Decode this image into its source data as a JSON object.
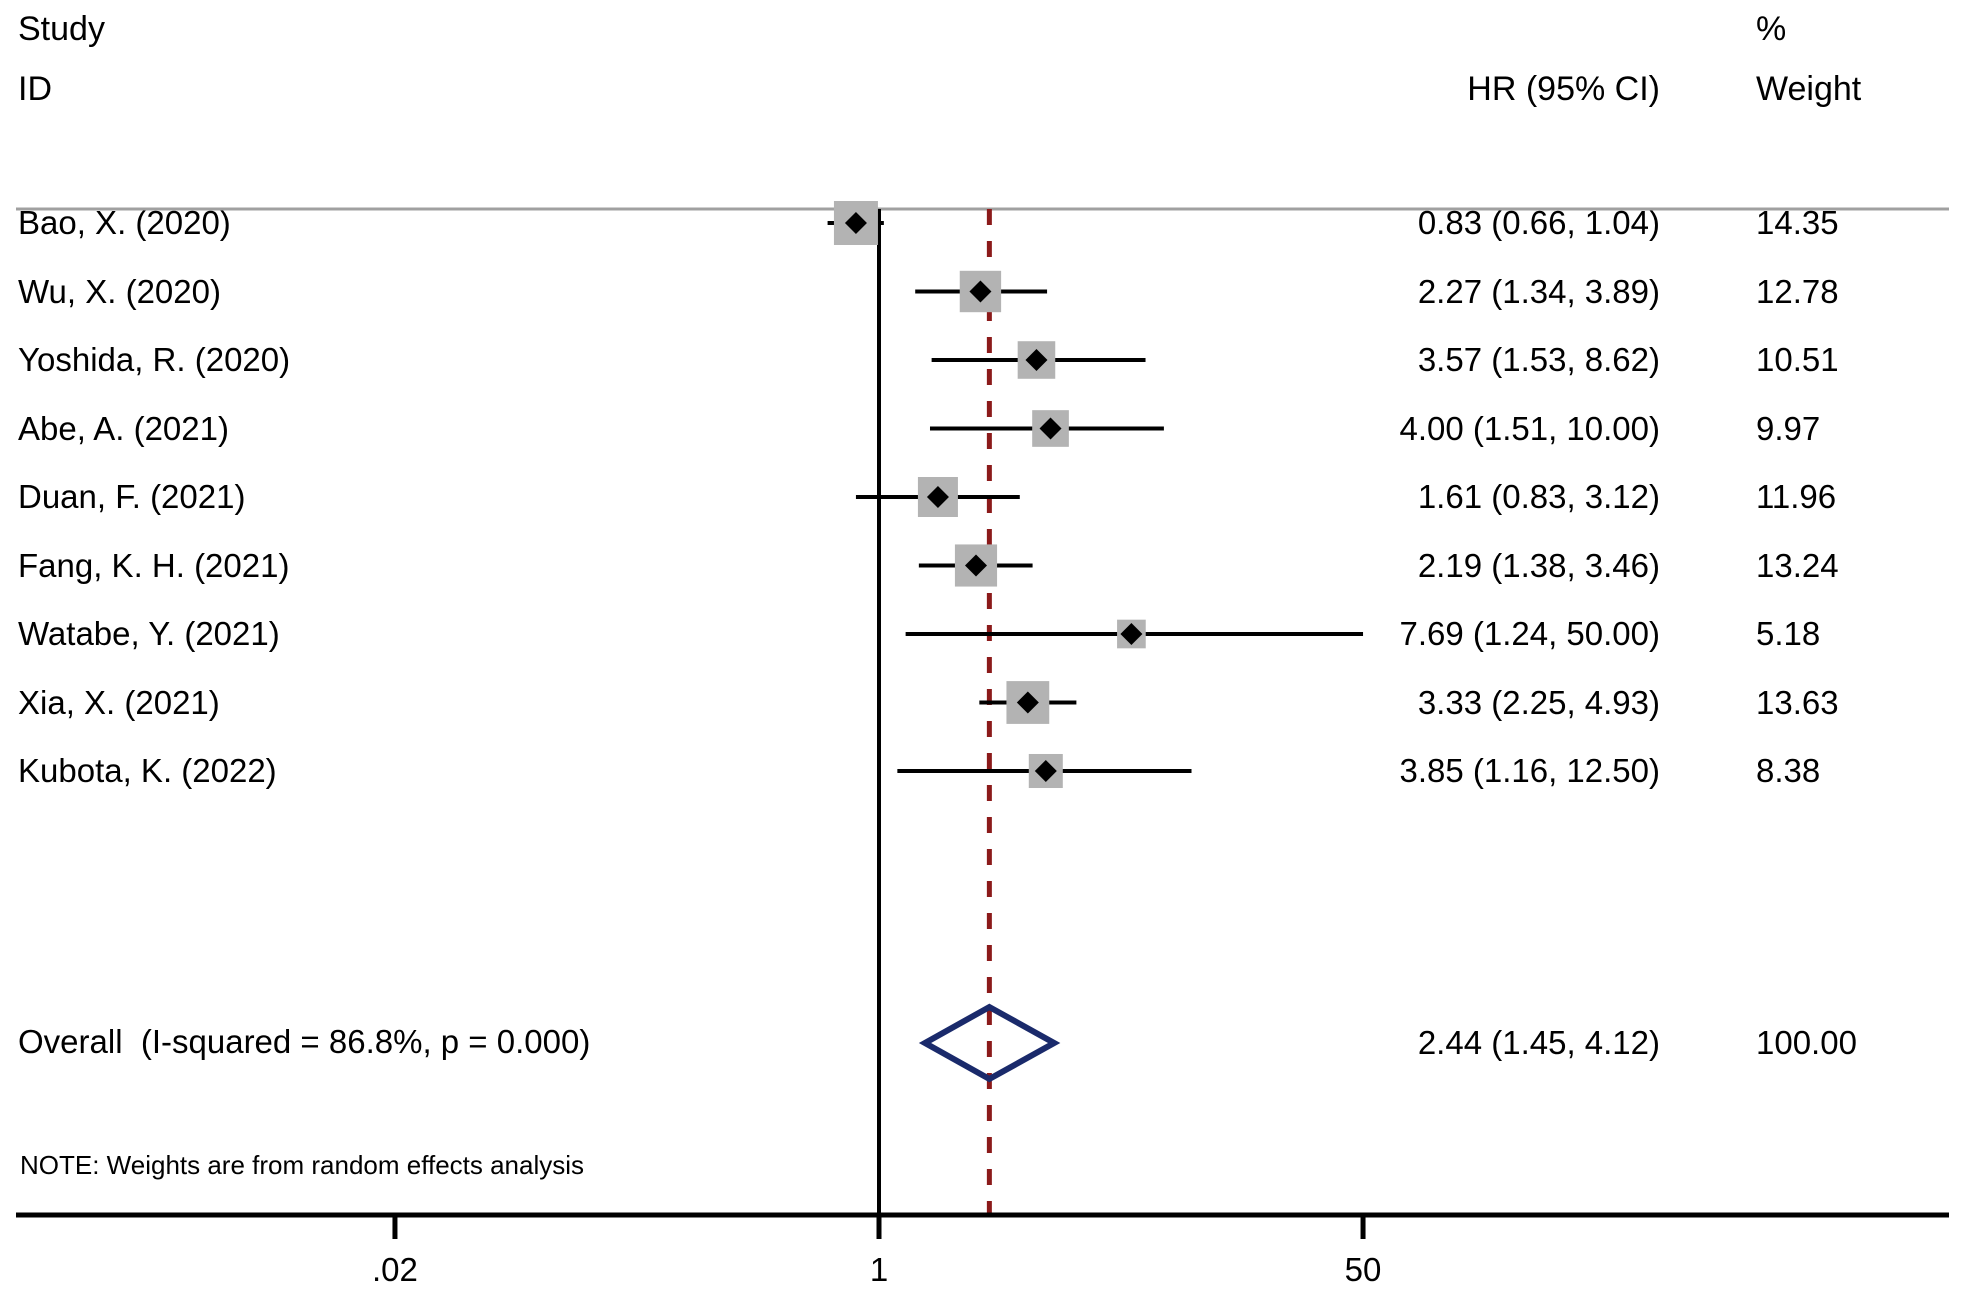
{
  "header": {
    "study_line1": "Study",
    "study_line2": "ID",
    "effect_line1": "",
    "effect_line2": "HR (95% CI)",
    "weight_line1": "%",
    "weight_line2": "Weight"
  },
  "note": "NOTE: Weights are from random effects analysis",
  "colors": {
    "marker_box": "#b3b3b3",
    "marker_point": "#000000",
    "ci_line": "#000000",
    "null_line": "#000000",
    "pooled_line": "#8b1a1a",
    "diamond": "#1a2a6b",
    "header_rule": "#a0a0a0",
    "axis": "#000000",
    "text": "#000000"
  },
  "chart_data": {
    "type": "forest",
    "title": "",
    "xlabel": "",
    "ylabel": "",
    "x_scale": "log",
    "xlim": [
      0.02,
      50
    ],
    "xticks": [
      0.02,
      1,
      50
    ],
    "xticklabels": [
      ".02",
      "1",
      "50"
    ],
    "grid": false,
    "null_value": 1,
    "pooled_reference_value": 2.44,
    "effect_measure": "HR (95% CI)",
    "heterogeneity": {
      "i_squared": "86.8%",
      "p_value": "0.000"
    },
    "columns": [
      "Study ID",
      "HR (95% CI)",
      "% Weight"
    ],
    "studies": [
      {
        "label": "Bao, X. (2020)",
        "effect": 0.83,
        "ci_low": 0.66,
        "ci_high": 1.04,
        "weight": 14.35,
        "effect_text": "0.83 (0.66, 1.04)",
        "weight_text": "14.35"
      },
      {
        "label": "Wu, X. (2020)",
        "effect": 2.27,
        "ci_low": 1.34,
        "ci_high": 3.89,
        "weight": 12.78,
        "effect_text": "2.27 (1.34, 3.89)",
        "weight_text": "12.78"
      },
      {
        "label": "Yoshida, R. (2020)",
        "effect": 3.57,
        "ci_low": 1.53,
        "ci_high": 8.62,
        "weight": 10.51,
        "effect_text": "3.57 (1.53, 8.62)",
        "weight_text": "10.51"
      },
      {
        "label": "Abe, A. (2021)",
        "effect": 4.0,
        "ci_low": 1.51,
        "ci_high": 10.0,
        "weight": 9.97,
        "effect_text": "4.00 (1.51, 10.00)",
        "weight_text": "9.97"
      },
      {
        "label": "Duan, F. (2021)",
        "effect": 1.61,
        "ci_low": 0.83,
        "ci_high": 3.12,
        "weight": 11.96,
        "effect_text": "1.61 (0.83, 3.12)",
        "weight_text": "11.96"
      },
      {
        "label": "Fang, K. H. (2021)",
        "effect": 2.19,
        "ci_low": 1.38,
        "ci_high": 3.46,
        "weight": 13.24,
        "effect_text": "2.19 (1.38, 3.46)",
        "weight_text": "13.24"
      },
      {
        "label": "Watabe, Y. (2021)",
        "effect": 7.69,
        "ci_low": 1.24,
        "ci_high": 50.0,
        "weight": 5.18,
        "effect_text": "7.69 (1.24, 50.00)",
        "weight_text": "5.18"
      },
      {
        "label": "Xia, X. (2021)",
        "effect": 3.33,
        "ci_low": 2.25,
        "ci_high": 4.93,
        "weight": 13.63,
        "effect_text": "3.33 (2.25, 4.93)",
        "weight_text": "13.63"
      },
      {
        "label": "Kubota, K. (2022)",
        "effect": 3.85,
        "ci_low": 1.16,
        "ci_high": 12.5,
        "weight": 8.38,
        "effect_text": "3.85 (1.16, 12.50)",
        "weight_text": "8.38"
      }
    ],
    "overall": {
      "label": "Overall  (I-squared = 86.8%, p = 0.000)",
      "effect": 2.44,
      "ci_low": 1.45,
      "ci_high": 4.12,
      "weight": 100.0,
      "effect_text": "2.44 (1.45, 4.12)",
      "weight_text": "100.00"
    }
  }
}
